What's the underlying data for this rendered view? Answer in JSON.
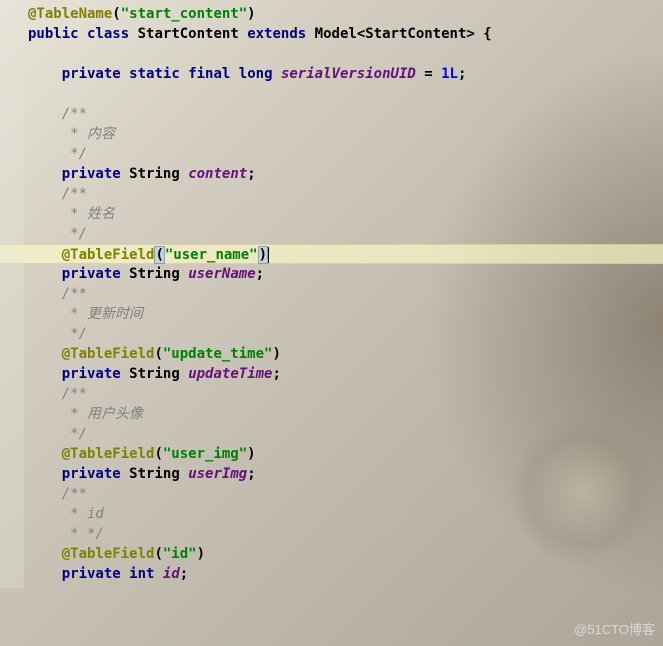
{
  "code": {
    "line1": {
      "annotation": "@TableName",
      "string": "\"start_content\""
    },
    "line2": {
      "kw1": "public",
      "kw2": "class",
      "classname": "StartContent",
      "kw3": "extends",
      "model": "Model",
      "generic": "StartContent"
    },
    "line4": {
      "kw1": "private",
      "kw2": "static",
      "kw3": "final",
      "kw4": "long",
      "field": "serialVersionUID",
      "val": "1L"
    },
    "block1": {
      "c1": "/**",
      "c2": " * 内容",
      "c3": " */",
      "kw": "private",
      "type": "String",
      "field": "content"
    },
    "block2": {
      "c1": "/**",
      "c2": " * 姓名",
      "c3": " */",
      "annotation": "@TableField",
      "string": "\"user_name\"",
      "kw": "private",
      "type": "String",
      "field": "userName"
    },
    "block3": {
      "c1": "/**",
      "c2": " * 更新时间",
      "c3": " */",
      "annotation": "@TableField",
      "string": "\"update_time\"",
      "kw": "private",
      "type": "String",
      "field": "updateTime"
    },
    "block4": {
      "c1": "/**",
      "c2": " * 用户头像",
      "c3": " */",
      "annotation": "@TableField",
      "string": "\"user_img\"",
      "kw": "private",
      "type": "String",
      "field": "userImg"
    },
    "block5": {
      "c1": "/**",
      "c2": " * id",
      "c3": " * */",
      "annotation": "@TableField",
      "string": "\"id\"",
      "kw": "private",
      "type": "int",
      "field": "id"
    }
  },
  "watermark": "@51CTO博客"
}
